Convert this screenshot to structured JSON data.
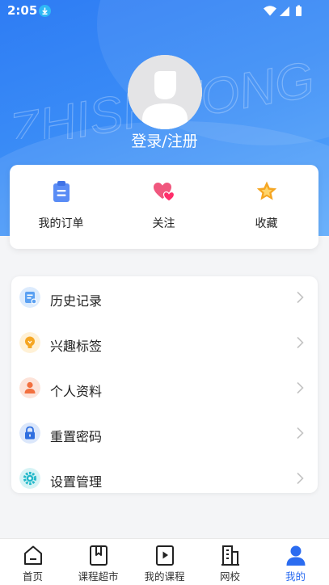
{
  "status_bar": {
    "time": "2:05"
  },
  "hero": {
    "watermark_text": "ZHISHITONG",
    "login_label": "登录/注册"
  },
  "quick_actions": [
    {
      "label": "我的订单",
      "icon": "clipboard-icon"
    },
    {
      "label": "关注",
      "icon": "hearts-icon"
    },
    {
      "label": "收藏",
      "icon": "star-icon"
    }
  ],
  "menu": [
    {
      "label": "历史记录",
      "icon": "history-icon"
    },
    {
      "label": "兴趣标签",
      "icon": "lightbulb-icon"
    },
    {
      "label": "个人资料",
      "icon": "person-icon"
    },
    {
      "label": "重置密码",
      "icon": "lock-icon"
    },
    {
      "label": "设置管理",
      "icon": "gear-icon"
    }
  ],
  "tabbar": [
    {
      "label": "首页",
      "icon": "home-icon",
      "active": false
    },
    {
      "label": "课程超市",
      "icon": "bookmark-book-icon",
      "active": false
    },
    {
      "label": "我的课程",
      "icon": "play-book-icon",
      "active": false
    },
    {
      "label": "网校",
      "icon": "building-icon",
      "active": false
    },
    {
      "label": "我的",
      "icon": "user-icon",
      "active": true
    }
  ],
  "colors": {
    "brand_blue": "#2e7cf4",
    "tab_active": "#2b6cf0"
  }
}
